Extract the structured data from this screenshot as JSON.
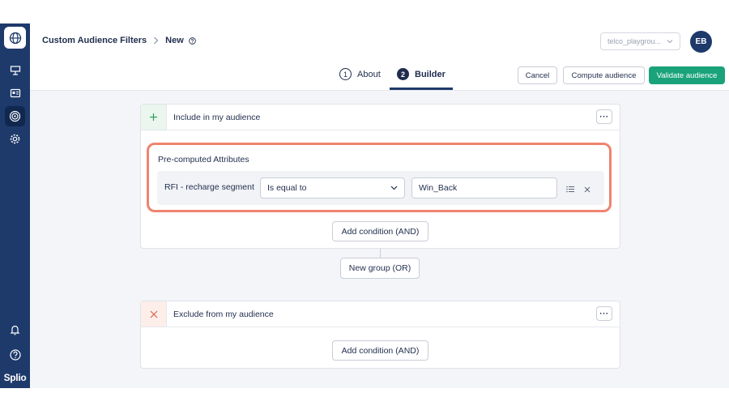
{
  "sidebar": {
    "logo_icon": "globe-icon",
    "items": [
      {
        "icon": "presentation-icon"
      },
      {
        "icon": "contact-card-icon"
      },
      {
        "icon": "target-icon",
        "active": true
      },
      {
        "icon": "gear-icon"
      }
    ],
    "bottom": [
      {
        "icon": "bell-icon"
      },
      {
        "icon": "help-icon"
      }
    ],
    "brand": "Splio"
  },
  "header": {
    "breadcrumb_parent": "Custom Audience Filters",
    "breadcrumb_current": "New",
    "env_select": "telco_playgrou...",
    "avatar_initials": "EB"
  },
  "tabs": [
    {
      "number": "1",
      "label": "About"
    },
    {
      "number": "2",
      "label": "Builder",
      "active": true
    }
  ],
  "actions": {
    "cancel": "Cancel",
    "compute": "Compute audience",
    "validate": "Validate audience"
  },
  "include": {
    "title": "Include in my audience",
    "more": "···",
    "group_label": "Pre-computed Attributes",
    "condition": {
      "attribute": "RFI - recharge segment",
      "operator": "Is equal to",
      "value": "Win_Back"
    },
    "add_condition": "Add condition (AND)"
  },
  "new_group": "New group (OR)",
  "exclude": {
    "title": "Exclude from my audience",
    "more": "···",
    "add_condition": "Add condition (AND)"
  },
  "colors": {
    "sidebar": "#1e3a6b",
    "primary": "#1aa37a",
    "highlight": "#ef8470"
  }
}
